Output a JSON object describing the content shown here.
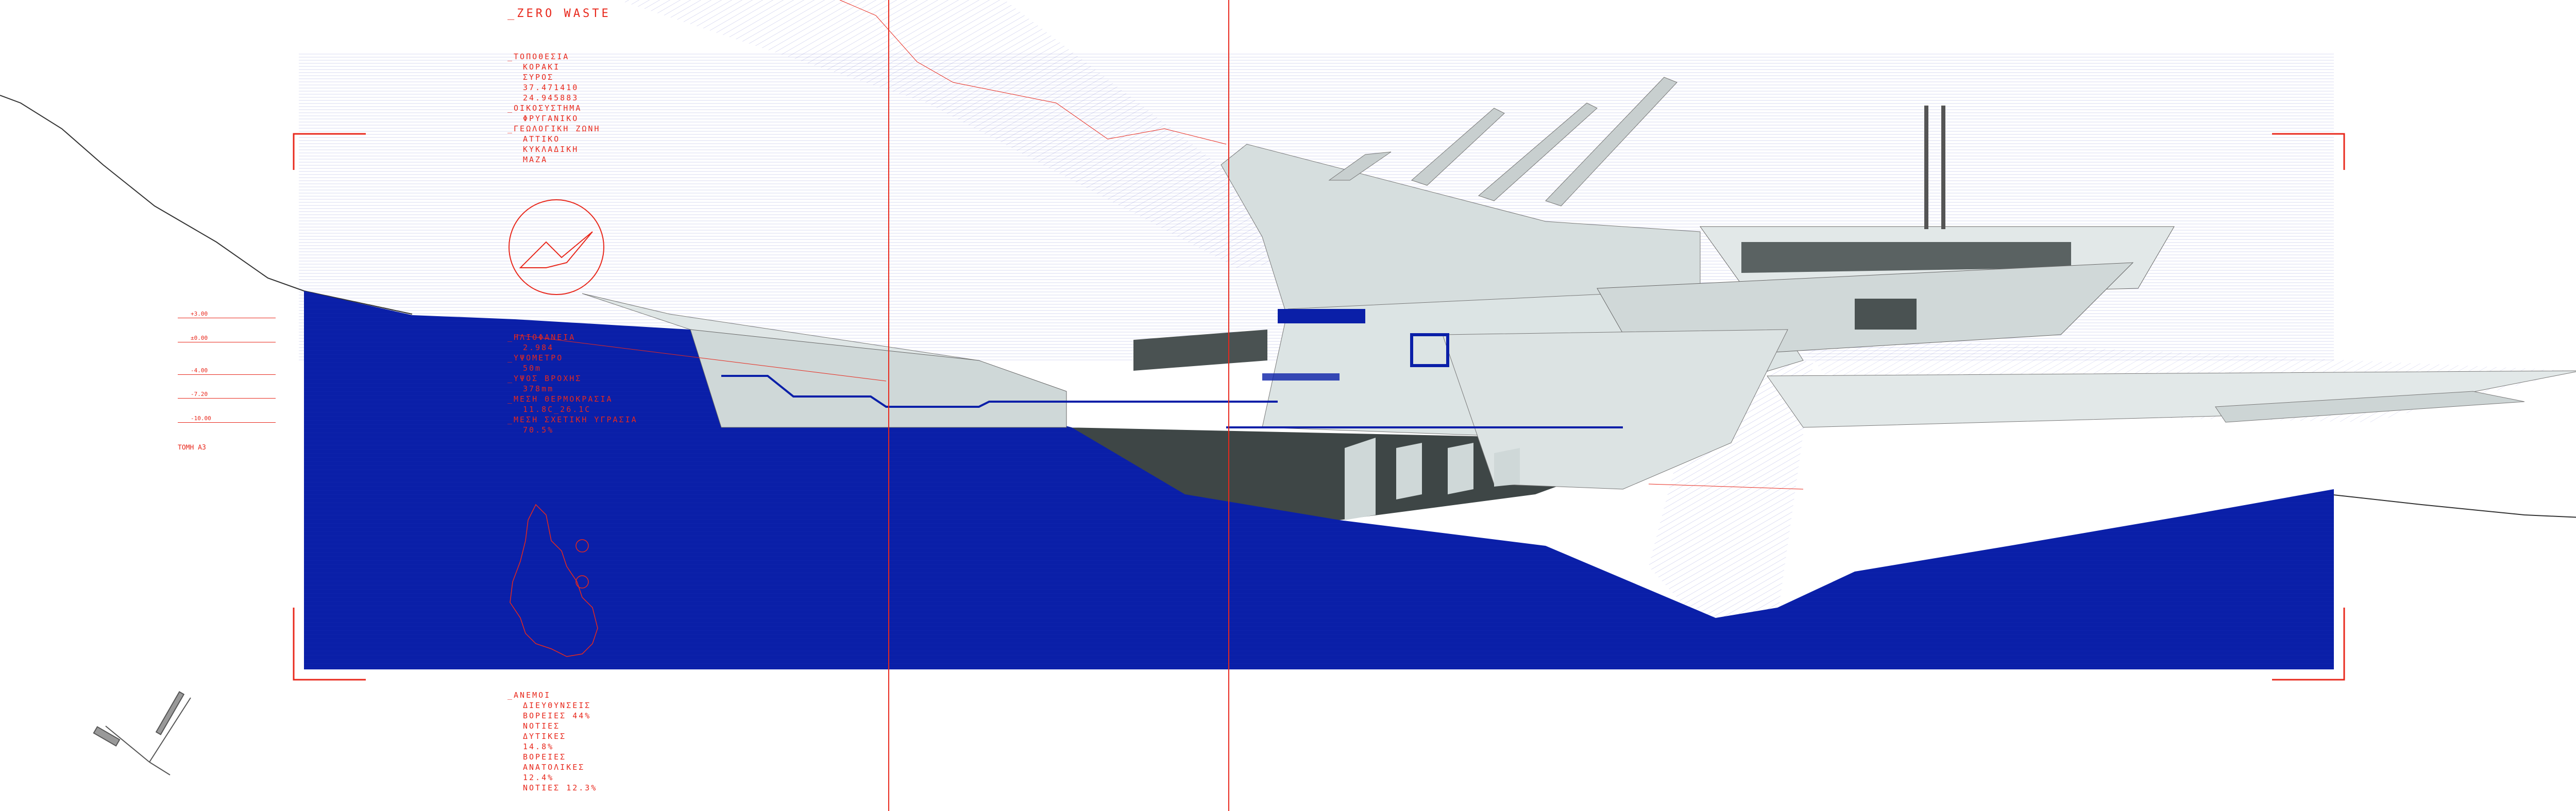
{
  "title": "_ZERO WASTE",
  "info_block": [
    {
      "label": "_ΤΟΠΟΘΕΣΙΑ",
      "lines": [
        "ΚΟΡΑΚΙ",
        "ΣΥΡΟΣ",
        "37.471410",
        "24.945883"
      ]
    },
    {
      "label": "_ΟΙΚΟΣΥΣΤΗΜΑ",
      "lines": [
        "ΦΡΥΓΑΝΙΚΟ"
      ]
    },
    {
      "label": "_ΓΕΩΛΟΓΙΚΗ ΖΩΝΗ",
      "lines": [
        "ΑΤΤΙΚΟ",
        "ΚΥΚΛΑΔΙΚΗ",
        "ΜΑΖΑ"
      ]
    }
  ],
  "climate_block": [
    {
      "label": "_ΗΛΙΟΦΑΝΕΙΑ",
      "lines": [
        "2.984"
      ]
    },
    {
      "label": "_ΥΨΟΜΕΤΡΟ",
      "lines": [
        "50m"
      ]
    },
    {
      "label": "_ΥΨΟΣ ΒΡΟΧΗΣ",
      "lines": [
        "378mm"
      ]
    },
    {
      "label": "_ΜΕΣΗ ΘΕΡΜΟΚΡΑΣΙΑ",
      "lines": [
        "11.8C_26.1C"
      ]
    },
    {
      "label": "_ΜΕΣΗ ΣΧΕΤΙΚΗ ΥΓΡΑΣΙΑ",
      "lines": [
        "70.5%"
      ]
    }
  ],
  "wind_block": [
    {
      "label": "_ΑΝΕΜΟΙ",
      "lines": [
        "ΔΙΕΥΘΥΝΣΕΙΣ",
        "ΒΟΡΕΙΕΣ 44%",
        "ΝΟΤΙΕΣ",
        "ΔΥΤΙΚΕΣ",
        "14.8%",
        "ΒΟΡΕΙΕΣ",
        "ΑΝΑΤΟΛΙΚΕΣ",
        "12.4%",
        "ΝΟΤΙΕΣ 12.3%"
      ]
    }
  ],
  "levels": [
    "+3.00",
    "±0.00",
    "-4.00",
    "-7.20",
    "-10.00"
  ],
  "section_label": "ΤΟΜΗ Α3",
  "colors": {
    "sea": "#0a1fa8",
    "accent": "#e8281c",
    "building_light": "#d8e0e0",
    "building_dark": "#3e4646",
    "hatch": "#6a6fc8"
  }
}
